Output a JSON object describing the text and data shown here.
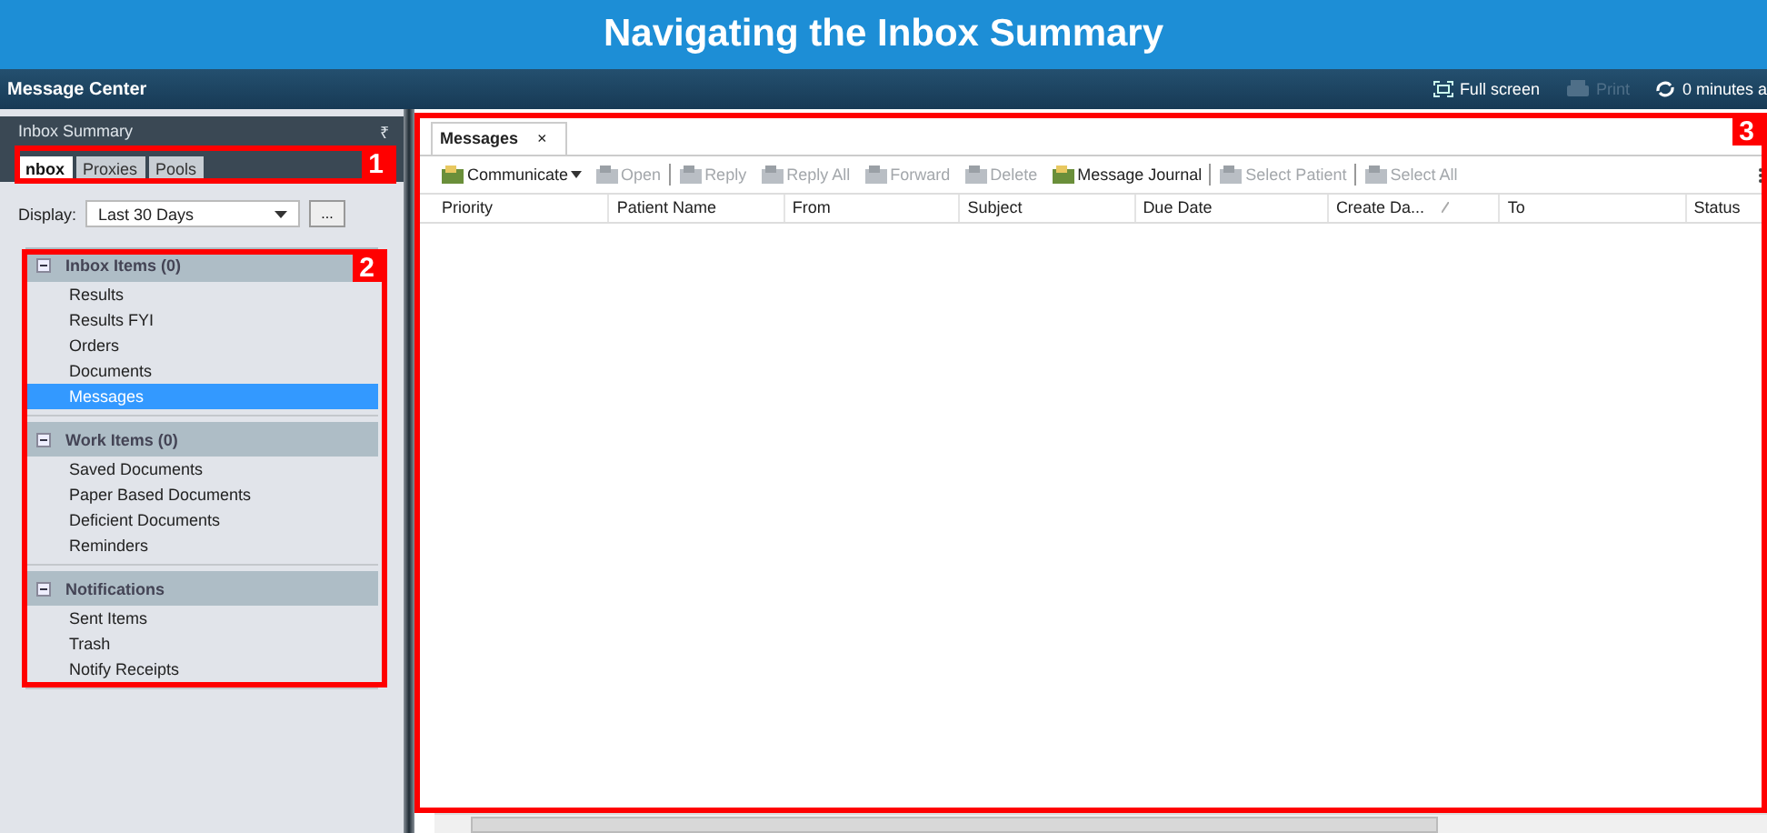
{
  "page_title": "Navigating the Inbox Summary",
  "app_bar": {
    "title": "Message Center",
    "actions": [
      {
        "label": "Full screen",
        "kind": "fullscreen",
        "disabled": false
      },
      {
        "label": "Print",
        "kind": "print",
        "disabled": true
      },
      {
        "label": "0 minutes a",
        "kind": "refresh",
        "disabled": false
      }
    ]
  },
  "sidebar": {
    "title": "Inbox Summary",
    "pin": "₹",
    "tabs": [
      {
        "label": "nbox",
        "selected": true
      },
      {
        "label": "Proxies",
        "selected": false
      },
      {
        "label": "Pools",
        "selected": false
      }
    ],
    "display": {
      "label": "Display:",
      "value": "Last 30 Days",
      "button": "..."
    },
    "groups": [
      {
        "title": "Inbox Items (0)",
        "expanded": true,
        "items": [
          {
            "label": "Results",
            "selected": false
          },
          {
            "label": "Results FYI",
            "selected": false
          },
          {
            "label": "Orders",
            "selected": false
          },
          {
            "label": "Documents",
            "selected": false
          },
          {
            "label": "Messages",
            "selected": true
          }
        ]
      },
      {
        "title": "Work Items (0)",
        "expanded": true,
        "items": [
          {
            "label": "Saved Documents",
            "selected": false
          },
          {
            "label": "Paper Based Documents",
            "selected": false
          },
          {
            "label": "Deficient Documents",
            "selected": false
          },
          {
            "label": "Reminders",
            "selected": false
          }
        ]
      },
      {
        "title": "Notifications",
        "expanded": true,
        "items": [
          {
            "label": "Sent Items",
            "selected": false
          },
          {
            "label": "Trash",
            "selected": false
          },
          {
            "label": "Notify Receipts",
            "selected": false
          }
        ]
      }
    ]
  },
  "main": {
    "tabs": [
      {
        "label": "Messages",
        "close": "×",
        "selected": true
      }
    ],
    "toolbar": [
      {
        "kind": "dropdown",
        "label": "Communicate",
        "disabled": false
      },
      {
        "kind": "button",
        "label": "Open",
        "disabled": true
      },
      {
        "kind": "separator"
      },
      {
        "kind": "button",
        "label": "Reply",
        "disabled": true
      },
      {
        "kind": "button",
        "label": "Reply All",
        "disabled": true
      },
      {
        "kind": "button",
        "label": "Forward",
        "disabled": true
      },
      {
        "kind": "button",
        "label": "Delete",
        "disabled": true
      },
      {
        "kind": "button",
        "label": "Message Journal",
        "disabled": false
      },
      {
        "kind": "separator"
      },
      {
        "kind": "button",
        "label": "Select Patient",
        "disabled": true
      },
      {
        "kind": "separator"
      },
      {
        "kind": "button",
        "label": "Select All",
        "disabled": true
      }
    ],
    "columns": [
      {
        "label": "Priority",
        "sorted": false
      },
      {
        "label": "Patient Name",
        "sorted": false
      },
      {
        "label": "From",
        "sorted": false
      },
      {
        "label": "Subject",
        "sorted": false
      },
      {
        "label": "Due Date",
        "sorted": false
      },
      {
        "label": "Create Da...",
        "sorted": true
      },
      {
        "label": "To",
        "sorted": false
      },
      {
        "label": "Status",
        "sorted": false
      }
    ]
  },
  "callouts": [
    {
      "number": "1"
    },
    {
      "number": "2"
    },
    {
      "number": "3"
    }
  ]
}
